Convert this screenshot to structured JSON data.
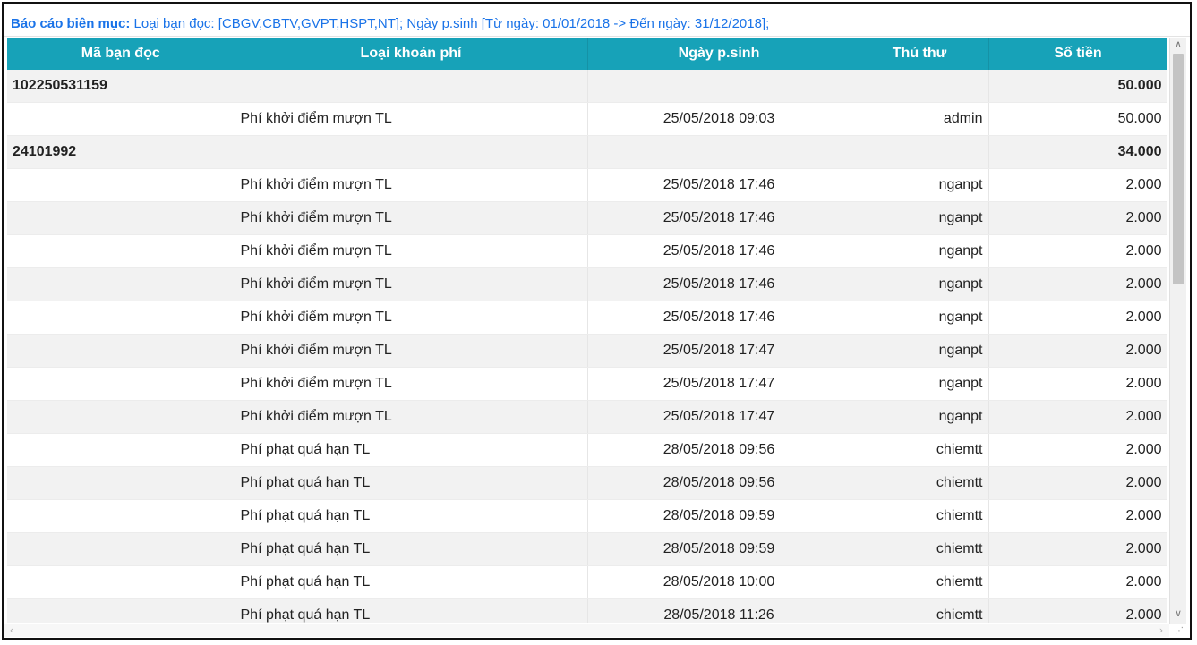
{
  "report": {
    "title_label": "Báo cáo biên mục:",
    "title_criteria": "Loại bạn đọc: [CBGV,CBTV,GVPT,HSPT,NT]; Ngày p.sinh [Từ ngày: 01/01/2018 -> Đến ngày: 31/12/2018];"
  },
  "table": {
    "columns": [
      "Mã bạn đọc",
      "Loại khoản phí",
      "Ngày p.sinh",
      "Thủ thư",
      "Số tiền"
    ],
    "rows": [
      {
        "type": "group",
        "cells": [
          "102250531159",
          "",
          "",
          "",
          "50.000"
        ]
      },
      {
        "type": "item",
        "cells": [
          "",
          "Phí khởi điểm mượn TL",
          "25/05/2018 09:03",
          "admin",
          "50.000"
        ]
      },
      {
        "type": "group",
        "cells": [
          "24101992",
          "",
          "",
          "",
          "34.000"
        ]
      },
      {
        "type": "item",
        "cells": [
          "",
          "Phí khởi điểm mượn TL",
          "25/05/2018 17:46",
          "nganpt",
          "2.000"
        ]
      },
      {
        "type": "item",
        "cells": [
          "",
          "Phí khởi điểm mượn TL",
          "25/05/2018 17:46",
          "nganpt",
          "2.000"
        ]
      },
      {
        "type": "item",
        "cells": [
          "",
          "Phí khởi điểm mượn TL",
          "25/05/2018 17:46",
          "nganpt",
          "2.000"
        ]
      },
      {
        "type": "item",
        "cells": [
          "",
          "Phí khởi điểm mượn TL",
          "25/05/2018 17:46",
          "nganpt",
          "2.000"
        ]
      },
      {
        "type": "item",
        "cells": [
          "",
          "Phí khởi điểm mượn TL",
          "25/05/2018 17:46",
          "nganpt",
          "2.000"
        ]
      },
      {
        "type": "item",
        "cells": [
          "",
          "Phí khởi điểm mượn TL",
          "25/05/2018 17:47",
          "nganpt",
          "2.000"
        ]
      },
      {
        "type": "item",
        "cells": [
          "",
          "Phí khởi điểm mượn TL",
          "25/05/2018 17:47",
          "nganpt",
          "2.000"
        ]
      },
      {
        "type": "item",
        "cells": [
          "",
          "Phí khởi điểm mượn TL",
          "25/05/2018 17:47",
          "nganpt",
          "2.000"
        ]
      },
      {
        "type": "item",
        "cells": [
          "",
          "Phí phạt quá hạn TL",
          "28/05/2018 09:56",
          "chiemtt",
          "2.000"
        ]
      },
      {
        "type": "item",
        "cells": [
          "",
          "Phí phạt quá hạn TL",
          "28/05/2018 09:56",
          "chiemtt",
          "2.000"
        ]
      },
      {
        "type": "item",
        "cells": [
          "",
          "Phí phạt quá hạn TL",
          "28/05/2018 09:59",
          "chiemtt",
          "2.000"
        ]
      },
      {
        "type": "item",
        "cells": [
          "",
          "Phí phạt quá hạn TL",
          "28/05/2018 09:59",
          "chiemtt",
          "2.000"
        ]
      },
      {
        "type": "item",
        "cells": [
          "",
          "Phí phạt quá hạn TL",
          "28/05/2018 10:00",
          "chiemtt",
          "2.000"
        ]
      },
      {
        "type": "item",
        "cells": [
          "",
          "Phí phạt quá hạn TL",
          "28/05/2018 11:26",
          "chiemtt",
          "2.000"
        ]
      }
    ]
  },
  "icons": {
    "scroll_up": "chevron-up-icon",
    "scroll_down": "chevron-down-icon",
    "scroll_left": "chevron-left-icon",
    "scroll_right": "chevron-right-icon",
    "resize": "resize-grip-icon"
  },
  "colors": {
    "header_bg": "#17a2b8",
    "title": "#1a73e8"
  }
}
